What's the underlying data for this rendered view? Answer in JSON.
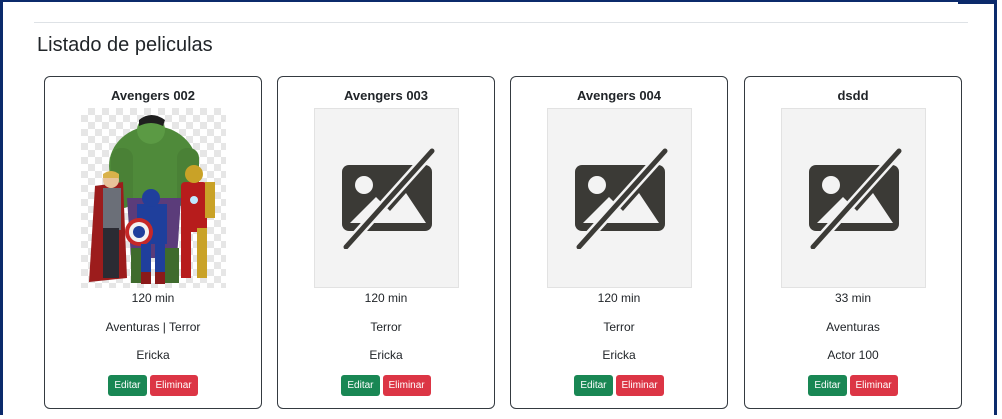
{
  "page": {
    "title": "Listado de peliculas"
  },
  "theme": {
    "edit_color": "#198754",
    "delete_color": "#dc3545",
    "border_color": "#0b2a6b"
  },
  "movies": [
    {
      "name": "Avengers 002",
      "duration": "120 min",
      "genre": "Aventuras | Terror",
      "actor": "Ericka",
      "image": "avengers-poster",
      "edit_label": "Editar",
      "delete_label": "Eliminar"
    },
    {
      "name": "Avengers 003",
      "duration": "120 min",
      "genre": "Terror",
      "actor": "Ericka",
      "image": "no-image-icon",
      "edit_label": "Editar",
      "delete_label": "Eliminar"
    },
    {
      "name": "Avengers 004",
      "duration": "120 min",
      "genre": "Terror",
      "actor": "Ericka",
      "image": "no-image-icon",
      "edit_label": "Editar",
      "delete_label": "Eliminar"
    },
    {
      "name": "dsdd",
      "duration": "33 min",
      "genre": "Aventuras",
      "actor": "Actor 100",
      "image": "no-image-icon",
      "edit_label": "Editar",
      "delete_label": "Eliminar"
    }
  ]
}
